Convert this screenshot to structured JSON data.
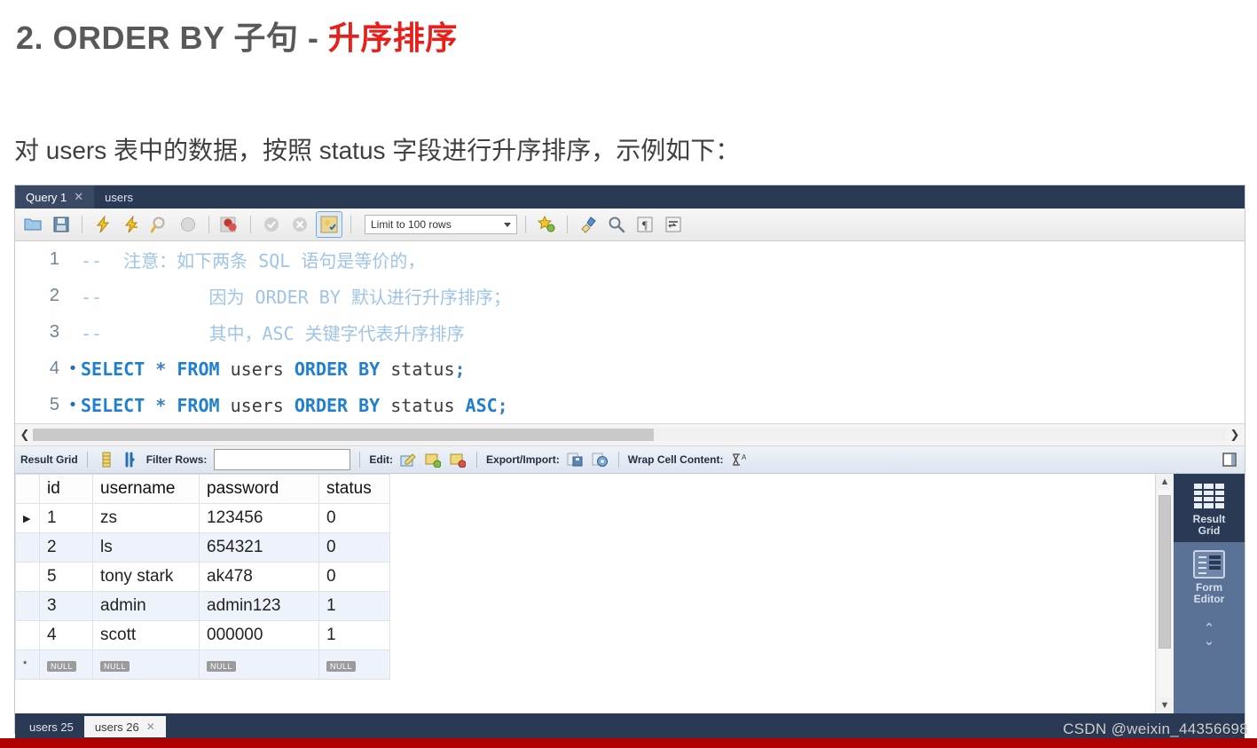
{
  "slide": {
    "title_main": "2. ORDER BY 子句 - ",
    "title_accent": "升序排序",
    "subtitle": "对 users 表中的数据，按照 status 字段进行升序排序，示例如下："
  },
  "colors": {
    "accent_red": "#e8201c",
    "title_gray": "#595959",
    "tab_bar": "#2b3a54",
    "side_panel": "#5a7296",
    "highlight_box": "#cc1111",
    "keyword_blue": "#1f7fd0",
    "comment_blue": "#9fc4e8",
    "bottom_bar": "#b00000"
  },
  "workbench": {
    "tabs": [
      {
        "label": "Query 1",
        "closable": true,
        "active": true
      },
      {
        "label": "users",
        "closable": false,
        "active": false
      }
    ],
    "toolbar": {
      "icons": [
        "open-file-icon",
        "save-file-icon",
        "execute-icon",
        "execute-current-statement-icon",
        "explain-query-icon",
        "stop-query-icon",
        "toggle-query-stop-icon",
        "commit-icon",
        "rollback-icon",
        "autocommit-icon"
      ],
      "limit_label": "Limit to 100 rows",
      "right_icons": [
        "snippets-icon",
        "beautify-query-icon",
        "find-icon",
        "toggle-invisible-chars-icon",
        "wrap-lines-icon"
      ]
    },
    "editor": {
      "lines": [
        {
          "number": "1",
          "marker": "",
          "tokens": [
            {
              "t": "comment",
              "s": "--  注意：如下两条 SQL 语句是等价的，"
            }
          ]
        },
        {
          "number": "2",
          "marker": "",
          "tokens": [
            {
              "t": "comment",
              "s": "--          因为 ORDER BY 默认进行升序排序；"
            }
          ]
        },
        {
          "number": "3",
          "marker": "",
          "tokens": [
            {
              "t": "comment",
              "s": "--          其中，ASC 关键字代表升序排序"
            }
          ]
        },
        {
          "number": "4",
          "marker": "•",
          "tokens": [
            {
              "t": "kw",
              "s": "SELECT"
            },
            {
              "t": "plain",
              "s": " "
            },
            {
              "t": "op",
              "s": "*"
            },
            {
              "t": "plain",
              "s": " "
            },
            {
              "t": "kw",
              "s": "FROM"
            },
            {
              "t": "plain",
              "s": " "
            },
            {
              "t": "id",
              "s": "users"
            },
            {
              "t": "plain",
              "s": " "
            },
            {
              "t": "kw",
              "s": "ORDER BY"
            },
            {
              "t": "plain",
              "s": " "
            },
            {
              "t": "id",
              "s": "status"
            },
            {
              "t": "op",
              "s": ";"
            }
          ]
        },
        {
          "number": "5",
          "marker": "•",
          "tokens": [
            {
              "t": "kw",
              "s": "SELECT"
            },
            {
              "t": "plain",
              "s": " "
            },
            {
              "t": "op",
              "s": "*"
            },
            {
              "t": "plain",
              "s": " "
            },
            {
              "t": "kw",
              "s": "FROM"
            },
            {
              "t": "plain",
              "s": " "
            },
            {
              "t": "id",
              "s": "users"
            },
            {
              "t": "plain",
              "s": " "
            },
            {
              "t": "kw",
              "s": "ORDER BY"
            },
            {
              "t": "plain",
              "s": " "
            },
            {
              "t": "id",
              "s": "status"
            },
            {
              "t": "plain",
              "s": " "
            },
            {
              "t": "kw",
              "s": "ASC"
            },
            {
              "t": "op",
              "s": ";"
            }
          ]
        }
      ],
      "highlight": "SELECT * FROM users"
    },
    "result_toolbar": {
      "result_grid_label": "Result Grid",
      "filter_label": "Filter Rows:",
      "filter_value": "",
      "filter_placeholder": "",
      "edit_label": "Edit:",
      "export_label": "Export/Import:",
      "wrap_label": "Wrap Cell Content:"
    },
    "result_grid": {
      "columns": [
        "id",
        "username",
        "password",
        "status"
      ],
      "rows": [
        {
          "id": "1",
          "username": "zs",
          "password": "123456",
          "status": "0",
          "marker": "▶"
        },
        {
          "id": "2",
          "username": "ls",
          "password": "654321",
          "status": "0",
          "marker": ""
        },
        {
          "id": "5",
          "username": "tony stark",
          "password": "ak478",
          "status": "0",
          "marker": ""
        },
        {
          "id": "3",
          "username": "admin",
          "password": "admin123",
          "status": "1",
          "marker": ""
        },
        {
          "id": "4",
          "username": "scott",
          "password": "000000",
          "status": "1",
          "marker": ""
        }
      ],
      "new_row": {
        "id": "NULL",
        "username": "NULL",
        "password": "NULL",
        "status": "NULL",
        "marker": "*"
      }
    },
    "side_panel": [
      {
        "icon": "result-grid-icon",
        "label_line1": "Result",
        "label_line2": "Grid",
        "active": true
      },
      {
        "icon": "form-editor-icon",
        "label_line1": "Form",
        "label_line2": "Editor",
        "active": false
      }
    ],
    "bottom_tabs": [
      {
        "label": "users 25",
        "closable": false,
        "selected": false
      },
      {
        "label": "users 26",
        "closable": true,
        "selected": true
      }
    ]
  },
  "watermark": "CSDN @weixin_44356698"
}
